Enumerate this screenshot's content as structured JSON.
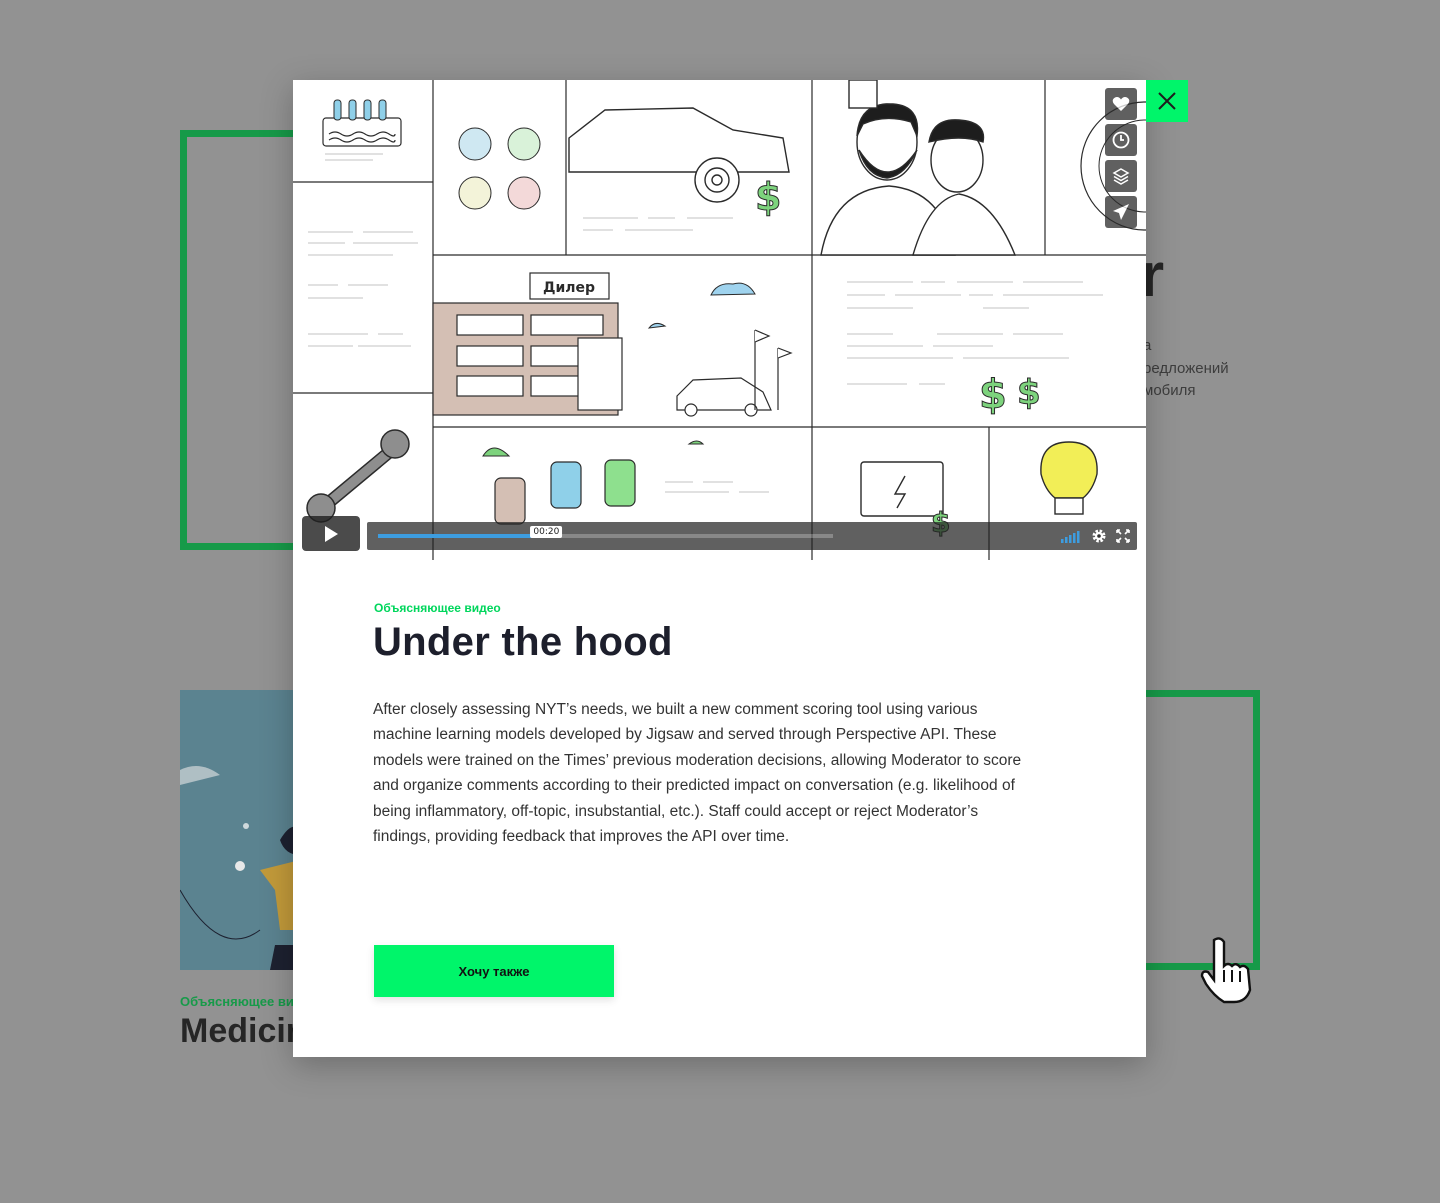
{
  "background": {
    "big_letter": "r",
    "side_text": "а\nредложений\nмобиля",
    "card_eyebrow": "Объясняющее ви",
    "card_title": "Medicir"
  },
  "modal": {
    "close_icon": "close-icon",
    "video": {
      "side_actions": [
        "heart-icon",
        "clock-icon",
        "layers-icon",
        "send-icon"
      ],
      "illustration_sign": "Дилер",
      "current_time": "00:20",
      "progress_percent": 37,
      "controls": [
        "play-icon",
        "volume-icon",
        "gear-icon",
        "fullscreen-icon"
      ]
    },
    "eyebrow": "Объясняющее видео",
    "title": "Under the hood",
    "body": "After closely assessing NYT’s needs, we built a new comment scoring tool using various machine learning models developed by Jigsaw and served through Perspective API. These models were trained on the Times’ previous moderation decisions, allowing Moderator to score and organize comments according to their predicted impact on conversation (e.g. likelihood of being inflammatory, off-topic, insubstantial, etc.). Staff could accept or reject Moderator’s findings, providing feedback that improves the API over time.",
    "cta_label": "Хочу также"
  },
  "colors": {
    "accent": "#00f56a",
    "accent_text": "#00d65c",
    "frame_green": "#179a49",
    "overlay": "#929292",
    "progress": "#3d9de0"
  }
}
